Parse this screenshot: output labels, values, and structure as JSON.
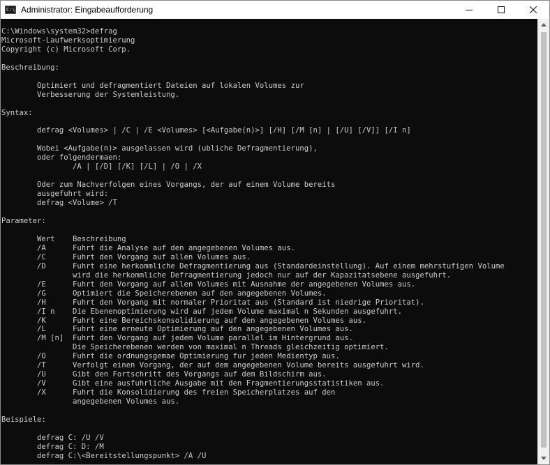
{
  "window": {
    "title": "Administrator: Eingabeaufforderung",
    "icon_text": "C:\\",
    "controls": [
      "minimize-icon",
      "maximize-icon",
      "close-icon"
    ]
  },
  "console": {
    "lines": [
      "C:\\Windows\\system32>defrag",
      "Microsoft-Laufwerksoptimierung",
      "Copyright (c) Microsoft Corp.",
      "",
      "Beschreibung:",
      "",
      "        Optimiert und defragmentiert Dateien auf lokalen Volumes zur",
      "        Verbesserung der Systemleistung.",
      "",
      "Syntax:",
      "",
      "        defrag <Volumes> | /C | /E <Volumes> [<Aufgabe(n)>] [/H] [/M [n] | [/U] [/V]] [/I n]",
      "",
      "        Wobei <Aufgabe(n)> ausgelassen wird (ubliche Defragmentierung),",
      "        oder folgendermaen:",
      "                /A | [/D] [/K] [/L] | /O | /X",
      "",
      "        Oder zum Nachverfolgen eines Vorgangs, der auf einem Volume bereits",
      "        ausgefuhrt wird:",
      "        defrag <Volume> /T",
      "",
      "Parameter:",
      "",
      "        Wert    Beschreibung",
      "        /A      Fuhrt die Analyse auf den angegebenen Volumes aus.",
      "        /C      Fuhrt den Vorgang auf allen Volumes aus.",
      "        /D      Fuhrt eine herkommliche Defragmentierung aus (Standardeinstellung). Auf einem mehrstufigen Volume",
      "                wird die herkommliche Defragmentierung jedoch nur auf der Kapazitatsebene ausgefuhrt.",
      "        /E      Fuhrt den Vorgang auf allen Volumes mit Ausnahme der angegebenen Volumes aus.",
      "        /G      Optimiert die Speicherebenen auf den angegebenen Volumes.",
      "        /H      Fuhrt den Vorgang mit normaler Prioritat aus (Standard ist niedrige Prioritat).",
      "        /I n    Die Ebenenoptimierung wird auf jedem Volume maximal n Sekunden ausgefuhrt.",
      "        /K      Fuhrt eine Bereichskonsolidierung auf den angegebenen Volumes aus.",
      "        /L      Fuhrt eine erneute Optimierung auf den angegebenen Volumes aus.",
      "        /M [n]  Fuhrt den Vorgang auf jedem Volume parallel im Hintergrund aus.",
      "                Die Speicherebenen werden von maximal n Threads gleichzeitig optimiert.",
      "        /O      Fuhrt die ordnungsgemae Optimierung fur jeden Medientyp aus.",
      "        /T      Verfolgt einen Vorgang, der auf dem angegebenen Volume bereits ausgefuhrt wird.",
      "        /U      Gibt den Fortschritt des Vorgangs auf dem Bildschirm aus.",
      "        /V      Gibt eine ausfuhrliche Ausgabe mit den Fragmentierungsstatistiken aus.",
      "        /X      Fuhrt die Konsolidierung des freien Speicherplatzes auf den",
      "                angegebenen Volumes aus.",
      "",
      "Beispiele:",
      "",
      "        defrag C: /U /V",
      "        defrag C: D: /M",
      "        defrag C:\\<Bereitstellungspunkt> /A /U"
    ]
  }
}
